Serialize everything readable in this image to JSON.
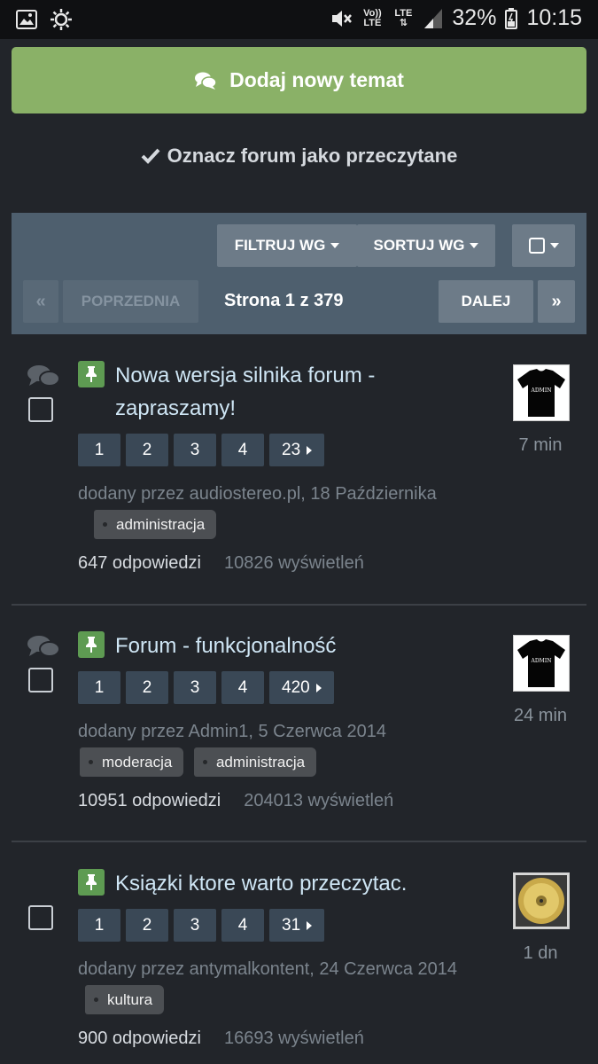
{
  "status_bar": {
    "icons_left": [
      "image-icon",
      "settings-icon"
    ],
    "volte_label": "Vo)) LTE",
    "lte_label": "LTE",
    "battery": "32%",
    "time": "10:15"
  },
  "actions": {
    "new_topic": "Dodaj nowy temat",
    "mark_read": "Oznacz forum jako przeczytane"
  },
  "filter_panel": {
    "filter_label": "FILTRUJ WG",
    "sort_label": "SORTUJ WG",
    "first_symbol": "«",
    "prev_label": "POPRZEDNIA",
    "page_info": "Strona 1 z 379",
    "next_label": "DALEJ",
    "last_symbol": "»"
  },
  "threads": [
    {
      "title": "Nowa wersja silnika forum - zapraszamy!",
      "pages": [
        "1",
        "2",
        "3",
        "4",
        "23"
      ],
      "meta": "dodany przez audiostereo.pl, 18 Października",
      "tags": [
        "administracja"
      ],
      "replies": "647 odpowiedzi",
      "views": "10826 wyświetleń",
      "last_post_time": "7 min",
      "avatar_text": "ADMIN"
    },
    {
      "title": "Forum - funkcjonalność",
      "pages": [
        "1",
        "2",
        "3",
        "4",
        "420"
      ],
      "meta": "dodany przez Admin1, 5 Czerwca 2014",
      "tags": [
        "moderacja",
        "administracja"
      ],
      "replies": "10951 odpowiedzi",
      "views": "204013 wyświetleń",
      "last_post_time": "24 min",
      "avatar_text": "ADMIN"
    },
    {
      "title": "Ksiązki ktore warto przeczytac.",
      "pages": [
        "1",
        "2",
        "3",
        "4",
        "31"
      ],
      "meta": "dodany przez antymalkontent, 24 Czerwca 2014",
      "tags": [
        "kultura"
      ],
      "replies": "900 odpowiedzi",
      "views": "16693 wyświetleń",
      "last_post_time": "1 dn",
      "avatar_text": ""
    }
  ],
  "colors": {
    "background": "#22252a",
    "accent_green": "#8ab167",
    "panel": "#4e5f6e",
    "title_link": "#cfe6f5"
  }
}
